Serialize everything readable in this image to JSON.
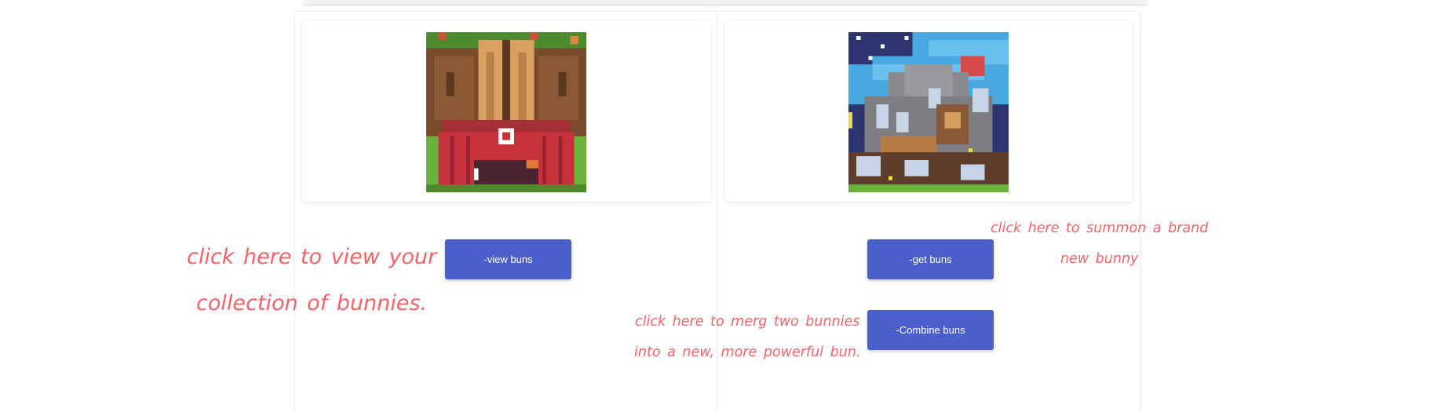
{
  "buttons": {
    "view": "-view buns",
    "get": "-get buns",
    "combine": "-Combine buns"
  },
  "hints": {
    "view": [
      "click here to view your",
      "collection of bunnies."
    ],
    "get": [
      "click here  to summon a brand",
      "new bunny"
    ],
    "combine": [
      "click here to merg two bunnies",
      "into a new, more powerful bun."
    ]
  },
  "images": {
    "barn": "barn pixel art",
    "mountain": "mountain pixel art"
  },
  "colors": {
    "button": "#4a5fc9",
    "hint_text": "#f0646a"
  }
}
